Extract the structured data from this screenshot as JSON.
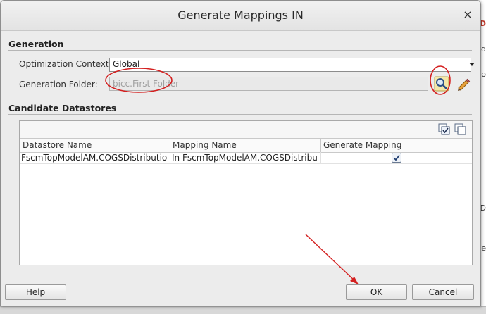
{
  "dialog": {
    "title": "Generate Mappings IN",
    "close_glyph": "×"
  },
  "generation": {
    "section_title": "Generation",
    "optimization_context_label": "Optimization Context:",
    "optimization_context_value": "Global",
    "generation_folder_label": "Generation Folder:",
    "generation_folder_value": "bicc.First Folder"
  },
  "candidates": {
    "section_title": "Candidate Datastores",
    "columns": [
      "Datastore Name",
      "Mapping Name",
      "Generate Mapping"
    ],
    "rows": [
      {
        "datastore_name": "FscmTopModelAM.COGSDistributio…",
        "mapping_name": "In FscmTopModelAM.COGSDistribu…",
        "generate_mapping": true
      }
    ]
  },
  "buttons": {
    "help_mnemonic": "H",
    "help_rest": "elp",
    "ok": "OK",
    "cancel": "Cancel"
  },
  "icons": {
    "search": "magnifier-icon",
    "edit": "pencil-icon",
    "select_all": "select-all-icon",
    "deselect_all": "deselect-all-icon"
  },
  "annotation_color": "#d42020",
  "background_fragments": [
    "D",
    "d",
    "o",
    "D",
    "e"
  ]
}
